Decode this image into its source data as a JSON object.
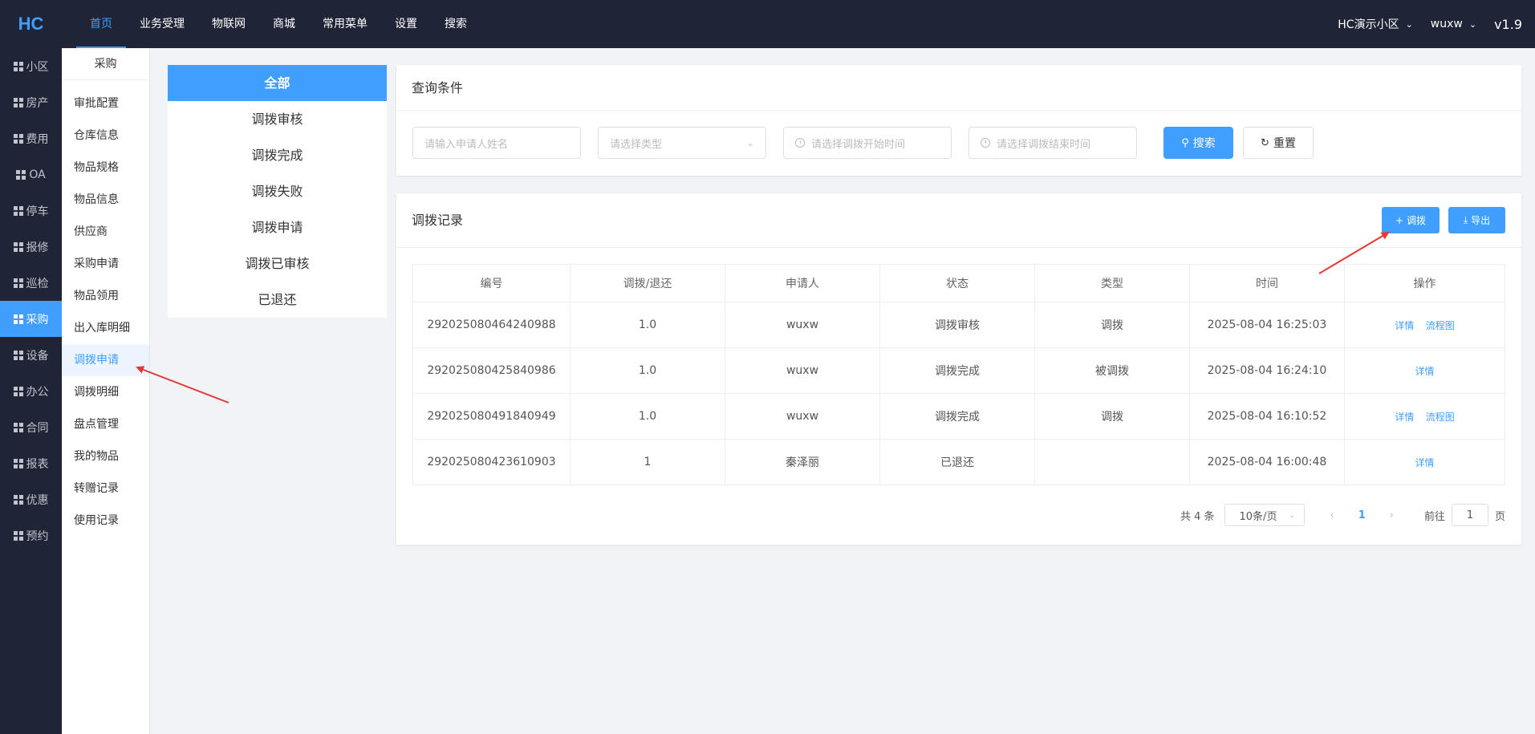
{
  "header": {
    "logo": "HC",
    "nav": [
      "首页",
      "业务受理",
      "物联网",
      "商城",
      "常用菜单",
      "设置",
      "搜索"
    ],
    "community": "HC演示小区",
    "user": "wuxw",
    "version": "v1.9"
  },
  "sidebar": {
    "items": [
      "小区",
      "房产",
      "费用",
      "OA",
      "停车",
      "报修",
      "巡检",
      "采购",
      "设备",
      "办公",
      "合同",
      "报表",
      "优惠",
      "预约"
    ],
    "active_index": 7
  },
  "submenu": {
    "title": "采购",
    "items": [
      "审批配置",
      "仓库信息",
      "物品规格",
      "物品信息",
      "供应商",
      "采购申请",
      "物品领用",
      "出入库明细",
      "调拨申请",
      "调拨明细",
      "盘点管理",
      "我的物品",
      "转赠记录",
      "使用记录"
    ],
    "active_index": 8
  },
  "categories": {
    "items": [
      "全部",
      "调拨审核",
      "调拨完成",
      "调拨失败",
      "调拨申请",
      "调拨已审核",
      "已退还"
    ]
  },
  "query": {
    "title": "查询条件",
    "applicant_placeholder": "请输入申请人姓名",
    "type_placeholder": "请选择类型",
    "start_placeholder": "请选择调拨开始时间",
    "end_placeholder": "请选择调拨结束时间",
    "search_label": "搜索",
    "reset_label": "重置"
  },
  "records": {
    "title": "调拨记录",
    "add_label": "调拨",
    "export_label": "导出",
    "columns": [
      "编号",
      "调拨/退还",
      "申请人",
      "状态",
      "类型",
      "时间",
      "操作"
    ],
    "rows": [
      {
        "id": "292025080464240988",
        "qty": "1.0",
        "applicant": "wuxw",
        "status": "调拨审核",
        "type": "调拨",
        "time": "2025-08-04 16:25:03",
        "detail": "详情",
        "flow": "流程图"
      },
      {
        "id": "292025080425840986",
        "qty": "1.0",
        "applicant": "wuxw",
        "status": "调拨完成",
        "type": "被调拨",
        "time": "2025-08-04 16:24:10",
        "detail": "详情",
        "flow": ""
      },
      {
        "id": "292025080491840949",
        "qty": "1.0",
        "applicant": "wuxw",
        "status": "调拨完成",
        "type": "调拨",
        "time": "2025-08-04 16:10:52",
        "detail": "详情",
        "flow": "流程图"
      },
      {
        "id": "292025080423610903",
        "qty": "1",
        "applicant": "秦泽丽",
        "status": "已退还",
        "type": "",
        "time": "2025-08-04 16:00:48",
        "detail": "详情",
        "flow": ""
      }
    ]
  },
  "pagination": {
    "total": "共 4 条",
    "page_size": "10条/页",
    "current": "1",
    "goto_label": "前往",
    "goto_value": "1",
    "page_suffix": "页"
  },
  "colors": {
    "accent": "#409eff",
    "dark": "#1f2436",
    "annotation_arrow": "#e53935"
  }
}
